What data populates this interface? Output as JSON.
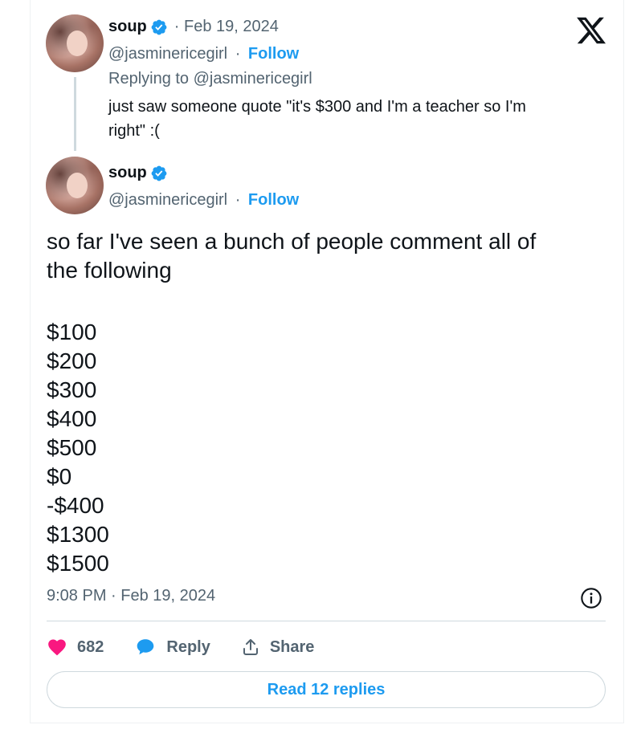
{
  "reply_tweet": {
    "author_name": "soup",
    "date_separator": "· Feb 19, 2024",
    "handle": "@jasminericegirl",
    "handle_separator": "·",
    "follow_label": "Follow",
    "replying_to": "Replying to @jasminericegirl",
    "text_line1": "just saw someone quote \"it's $300 and I'm a teacher so I'm",
    "text_line2": "right\" :("
  },
  "main_tweet": {
    "author_name": "soup",
    "handle": "@jasminericegirl",
    "handle_separator": "·",
    "follow_label": "Follow",
    "text_line1": "so far I've seen a bunch of people comment all of",
    "text_line2": "the following",
    "amounts": [
      "$100",
      "$200",
      "$300",
      "$400",
      "$500",
      "$0",
      "-$400",
      "$1300",
      "$1500"
    ],
    "timestamp": "9:08 PM · Feb 19, 2024"
  },
  "actions": {
    "like_count": "682",
    "reply_label": "Reply",
    "share_label": "Share"
  },
  "read_replies_label": "Read 12 replies",
  "colors": {
    "accent_blue": "#1d9bf0",
    "like_pink": "#f91880",
    "muted_text": "#536471",
    "border": "#cfd9de"
  },
  "icons": [
    "x-logo-icon",
    "verified-badge-icon",
    "heart-icon",
    "reply-bubble-icon",
    "share-icon",
    "info-icon"
  ]
}
